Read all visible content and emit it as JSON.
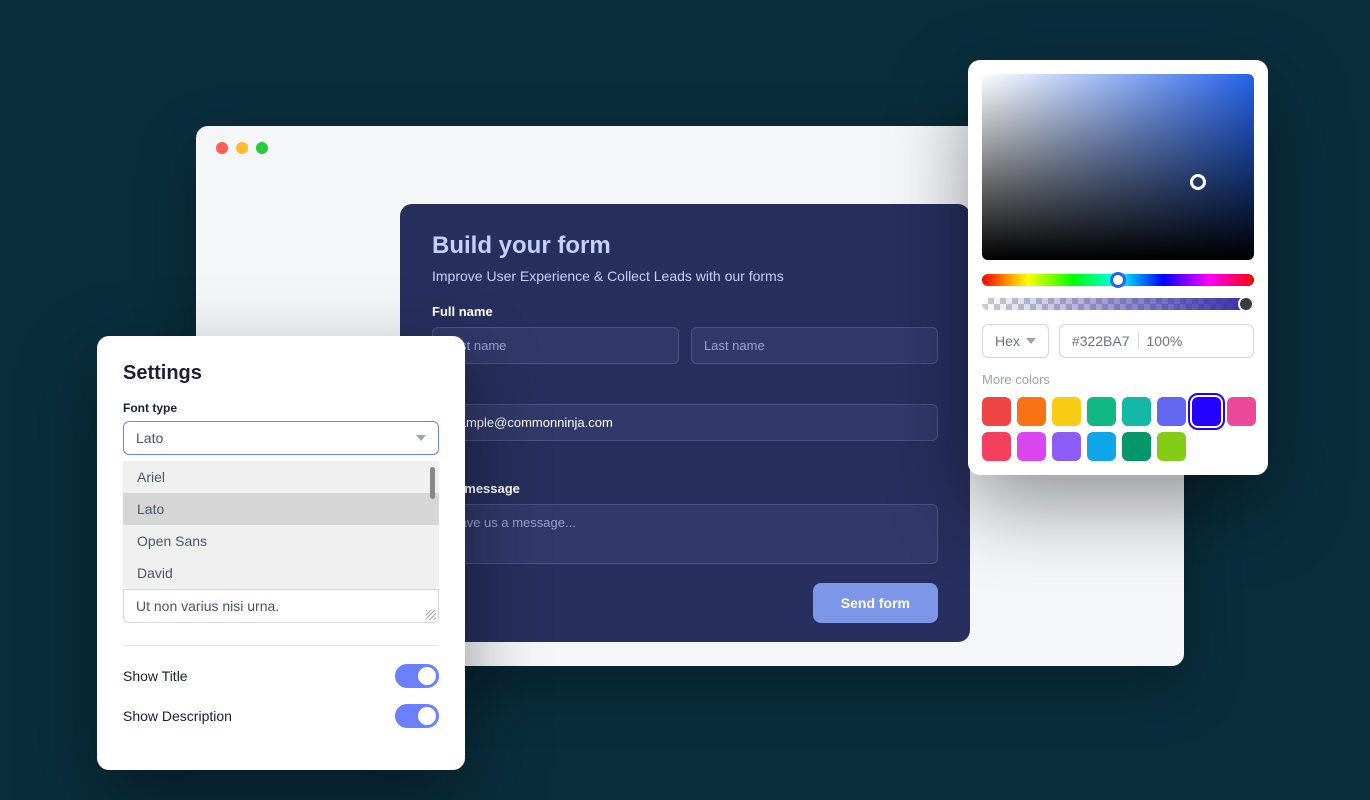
{
  "browser": {
    "window_controls": [
      "red",
      "yellow",
      "green"
    ]
  },
  "form": {
    "title": "Build your form",
    "subtitle": "Improve User Experience & Collect Leads with our forms",
    "fullname_label": "Full name",
    "firstname_placeholder": "First name",
    "lastname_placeholder": "Last name",
    "email_value": "example@commonninja.com",
    "message_label": "Your message",
    "message_placeholder": "Leave us a message...",
    "send_button": "Send form"
  },
  "settings": {
    "title": "Settings",
    "font_type_label": "Font type",
    "font_selected": "Lato",
    "font_options": [
      "Ariel",
      "Lato",
      "Open Sans",
      "David"
    ],
    "description_value": "Ut non varius nisi urna.",
    "show_title_label": "Show Title",
    "show_title_on": true,
    "show_description_label": "Show Description",
    "show_description_on": true
  },
  "color_picker": {
    "mode": "Hex",
    "hex_value": "#322BA7",
    "alpha_value": "100%",
    "more_colors_label": "More colors",
    "swatches": [
      {
        "color": "#ef4444",
        "selected": false
      },
      {
        "color": "#f97316",
        "selected": false
      },
      {
        "color": "#facc15",
        "selected": false
      },
      {
        "color": "#10b981",
        "selected": false
      },
      {
        "color": "#14b8a6",
        "selected": false
      },
      {
        "color": "#6366f1",
        "selected": false
      },
      {
        "color": "#2300ff",
        "selected": true
      },
      {
        "color": "#ec4899",
        "selected": false
      },
      {
        "color": "#f43f5e",
        "selected": false
      },
      {
        "color": "#d946ef",
        "selected": false
      },
      {
        "color": "#8b5cf6",
        "selected": false
      },
      {
        "color": "#0ea5e9",
        "selected": false
      },
      {
        "color": "#059669",
        "selected": false
      },
      {
        "color": "#84cc16",
        "selected": false
      }
    ]
  }
}
